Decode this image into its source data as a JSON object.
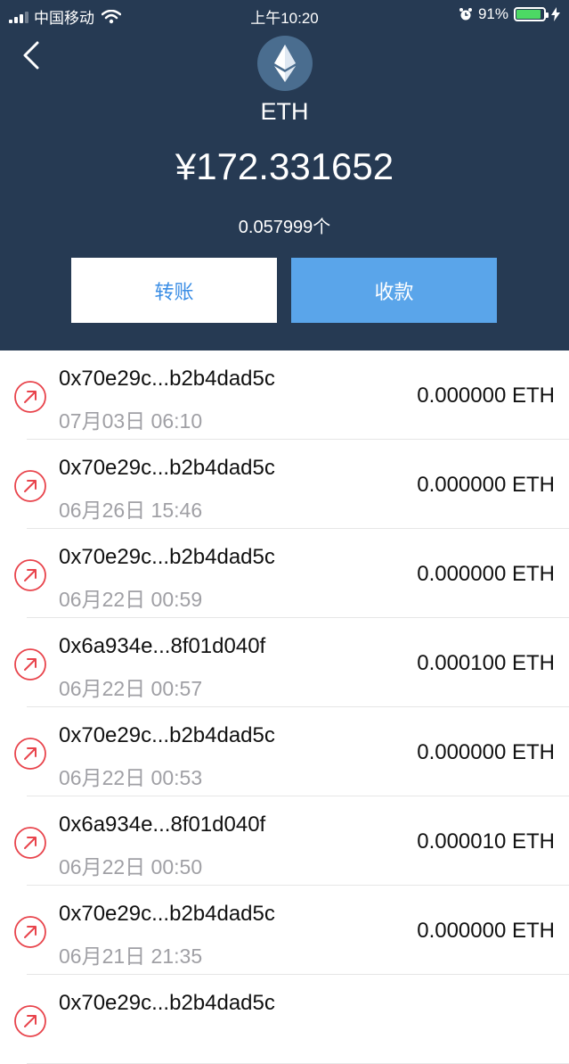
{
  "status_bar": {
    "carrier": "中国移动",
    "time": "上午10:20",
    "battery_text": "91%",
    "battery_level": 0.91,
    "icons": [
      "signal-icon",
      "wifi-icon",
      "alarm-icon",
      "battery-icon",
      "charging-icon"
    ]
  },
  "header": {
    "coin_name": "ETH",
    "balance": "¥172.331652",
    "quantity": "0.057999个",
    "transfer_label": "转账",
    "receive_label": "收款"
  },
  "colors": {
    "header_bg": "#263a53",
    "accent_blue": "#5aa5ea",
    "send_red": "#e8434b"
  },
  "transactions": [
    {
      "address": "0x70e29c...b2b4dad5c",
      "time": "07月03日 06:10",
      "amount": "0.000000 ETH"
    },
    {
      "address": "0x70e29c...b2b4dad5c",
      "time": "06月26日 15:46",
      "amount": "0.000000 ETH"
    },
    {
      "address": "0x70e29c...b2b4dad5c",
      "time": "06月22日 00:59",
      "amount": "0.000000 ETH"
    },
    {
      "address": "0x6a934e...8f01d040f",
      "time": "06月22日 00:57",
      "amount": "0.000100 ETH"
    },
    {
      "address": "0x70e29c...b2b4dad5c",
      "time": "06月22日 00:53",
      "amount": "0.000000 ETH"
    },
    {
      "address": "0x6a934e...8f01d040f",
      "time": "06月22日 00:50",
      "amount": "0.000010 ETH"
    },
    {
      "address": "0x70e29c...b2b4dad5c",
      "time": "06月21日 21:35",
      "amount": "0.000000 ETH"
    },
    {
      "address": "0x70e29c...b2b4dad5c",
      "time": "",
      "amount": ""
    }
  ]
}
